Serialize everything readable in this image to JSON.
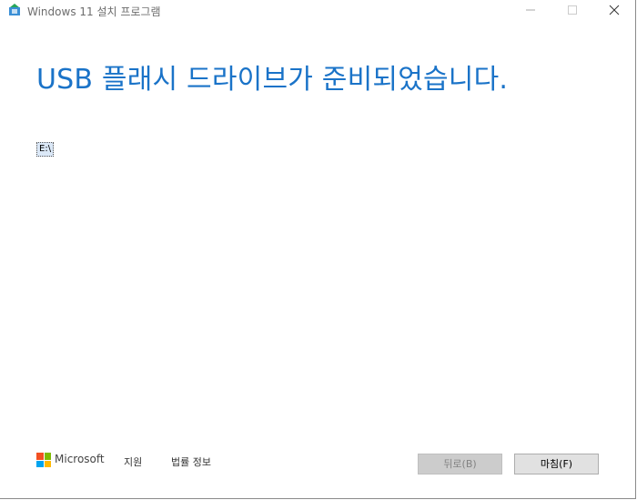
{
  "window": {
    "title": "Windows 11 설치 프로그램",
    "app_icon": "setup-app-icon",
    "controls": [
      "minimize-icon",
      "maximize-icon",
      "close-icon"
    ]
  },
  "main": {
    "heading": "USB 플래시 드라이브가 준비되었습니다.",
    "drive_label": "E:\\"
  },
  "footer": {
    "brand": "Microsoft",
    "brand_colors": [
      "#f25022",
      "#7fba00",
      "#00a4ef",
      "#ffb900"
    ],
    "support_label": "지원",
    "legal_label": "법률 정보",
    "back_label": "뒤로(B)",
    "finish_label": "마침(F)"
  },
  "colors": {
    "heading": "#1a73c8",
    "button_disabled_bg": "#cccccc",
    "button_bg": "#e1e1e1"
  }
}
